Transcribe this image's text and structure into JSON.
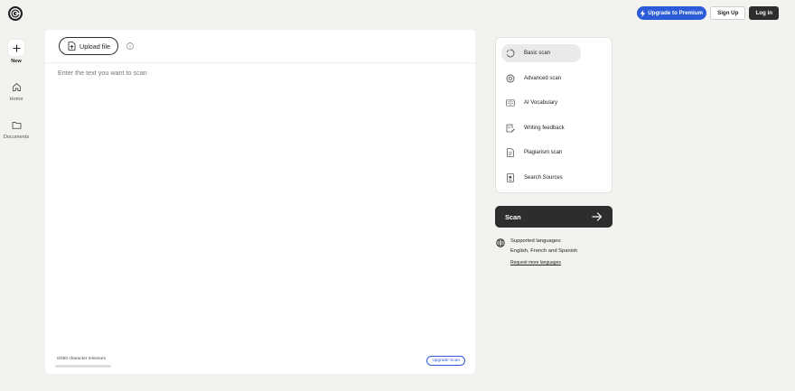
{
  "header": {
    "premium_label": "Upgrade to Premium",
    "signup_label": "Sign Up",
    "login_label": "Log in"
  },
  "sidebar": {
    "items": [
      {
        "label": "New"
      },
      {
        "label": "Home"
      },
      {
        "label": "Documents"
      }
    ]
  },
  "editor": {
    "upload_label": "Upload file",
    "placeholder": "Enter the text you want to scan",
    "char_count": "0/250 character minimum",
    "char_progress": 0,
    "upgrade_label": "Upgrade Scan"
  },
  "scan_options": [
    {
      "label": "Basic scan",
      "icon": "basic-scan-icon",
      "active": true
    },
    {
      "label": "Advanced scan",
      "icon": "advanced-scan-icon",
      "active": false
    },
    {
      "label": "AI Vocabulary",
      "icon": "vocabulary-icon",
      "active": false
    },
    {
      "label": "Writing feedback",
      "icon": "writing-feedback-icon",
      "active": false
    },
    {
      "label": "Plagiarism scan",
      "icon": "plagiarism-icon",
      "active": false
    },
    {
      "label": "Search Sources",
      "icon": "search-sources-icon",
      "active": false
    }
  ],
  "scan_button": {
    "label": "Scan"
  },
  "languages": {
    "title": "Supported languages:",
    "list": "English, French and Spanish",
    "link": "Request more languages"
  },
  "colors": {
    "accent": "#2b5bd7",
    "dark": "#2d2d2d",
    "background": "#f4f2ee"
  }
}
